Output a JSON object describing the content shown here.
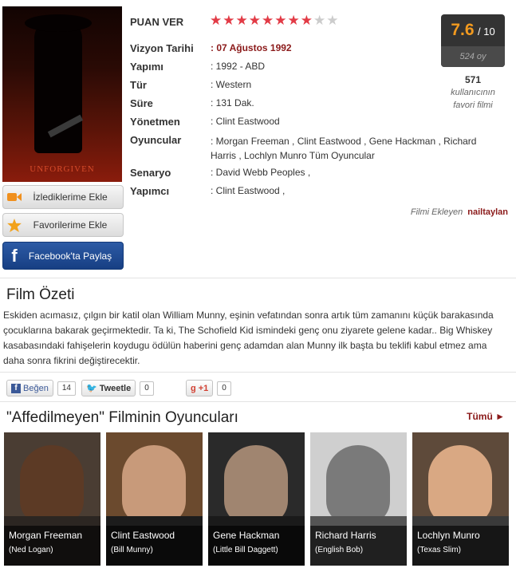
{
  "poster": {
    "title": "UNFORGIVEN"
  },
  "rating": {
    "label": "PUAN VER",
    "stars_filled": 8,
    "stars_total": 10,
    "filled_color": "#e23b46",
    "empty_color": "#cccccc"
  },
  "score": {
    "value": "7.6",
    "max": "/ 10",
    "votes": "524 oy"
  },
  "favorites": {
    "count": "571",
    "text1": "kullanıcının",
    "text2": "favori filmi"
  },
  "info": [
    {
      "label": "Vizyon Tarihi",
      "value": ": 07 Ağustos 1992"
    },
    {
      "label": "Yapımı",
      "value": ": 1992 - ABD"
    },
    {
      "label": "Tür",
      "value": ": Western"
    },
    {
      "label": "Süre",
      "value": ": 131 Dak."
    },
    {
      "label": "Yönetmen",
      "value": ": Clint Eastwood"
    },
    {
      "label": "Oyuncular",
      "value": ": Morgan Freeman ,  Clint Eastwood ,  Gene Hackman ,  Richard Harris ,  Lochlyn Munro Tüm Oyuncular"
    },
    {
      "label": "Senaryo",
      "value": ": David Webb Peoples ,"
    },
    {
      "label": "Yapımcı",
      "value": ": Clint Eastwood ,"
    }
  ],
  "buttons": {
    "watch": "İzlediklerime Ekle",
    "fav": "Favorilerime Ekle",
    "facebook": "Facebook'ta Paylaş"
  },
  "adder": {
    "label": "Filmi Ekleyen",
    "user": "nailtaylan"
  },
  "summary": {
    "heading": "Film Özeti",
    "text": "Eskiden acımasız, çılgın bir katil olan William Munny, eşinin vefatından sonra artık tüm zamanını küçük barakasında çocuklarına bakarak geçirmektedir. Ta ki, The Schofield Kid ismindeki genç onu ziyarete gelene kadar.. Big Whiskey kasabasındaki fahişelerin koydugu ödülün haberini genç adamdan alan Munny ilk başta bu teklifi kabul etmez ama daha sonra fikrini değiştirecektir."
  },
  "social": {
    "like_label": "Beğen",
    "like_count": "14",
    "tweet_label": "Tweetle",
    "tweet_count": "0",
    "plus_label": "+1",
    "plus_count": "0",
    "fb_letter": "f",
    "g_letter": "g"
  },
  "cast_section": {
    "heading": "\"Affedilmeyen\" Filminin Oyuncuları",
    "all_label": "Tümü ►",
    "actors": [
      {
        "name": "Morgan Freeman",
        "role": "(Ned Logan)"
      },
      {
        "name": "Clint Eastwood",
        "role": "(Bill Munny)"
      },
      {
        "name": "Gene Hackman",
        "role": "(Little Bill Daggett)"
      },
      {
        "name": "Richard Harris",
        "role": "(English Bob)"
      },
      {
        "name": "Lochlyn Munro",
        "role": "(Texas Slim)"
      }
    ]
  }
}
